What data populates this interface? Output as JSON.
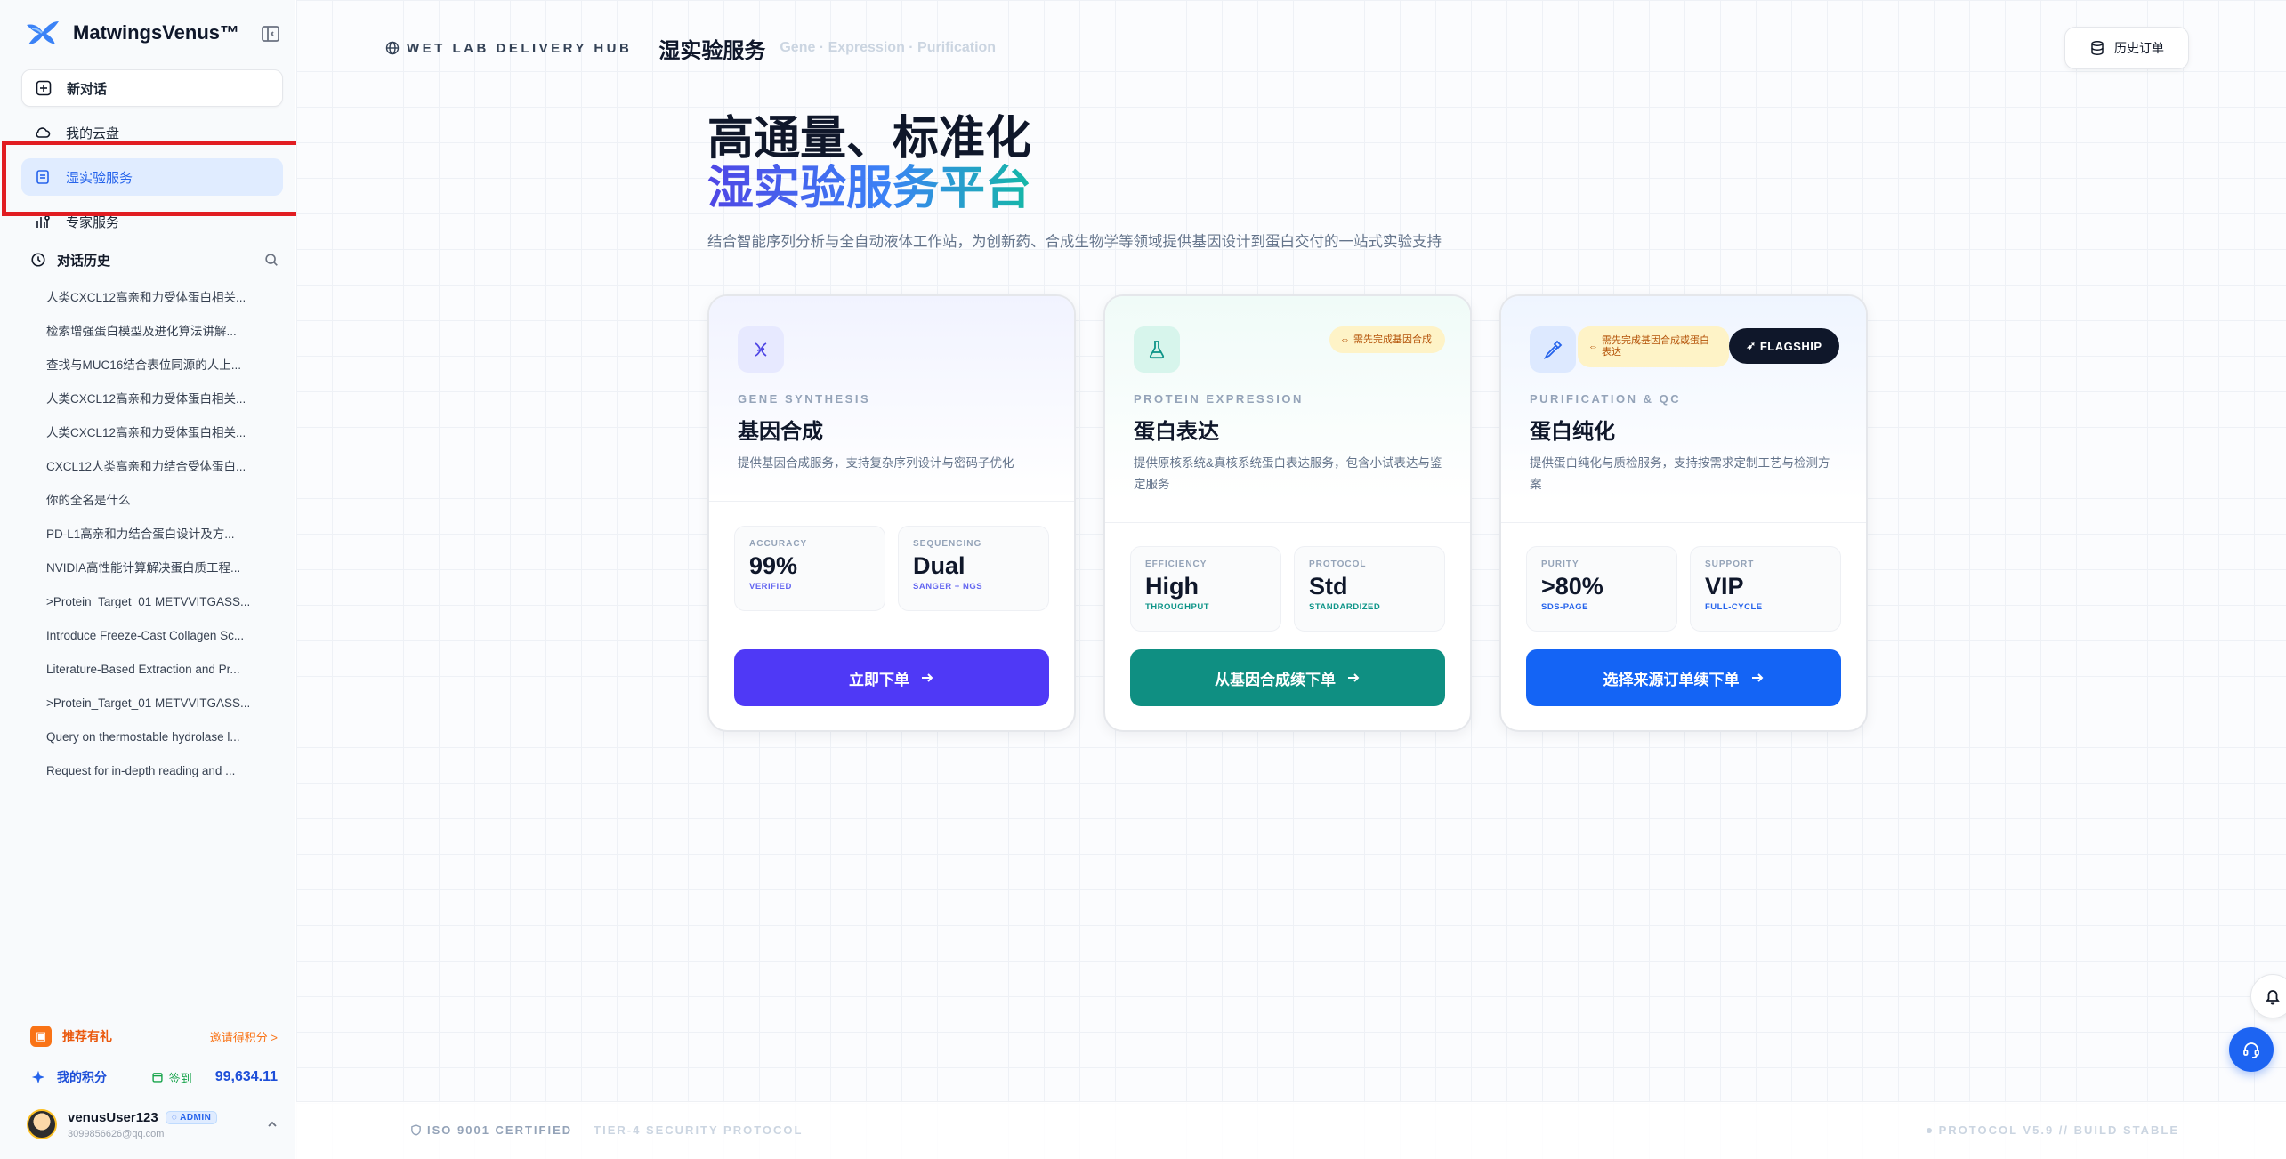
{
  "sidebar": {
    "brand": "MatwingsVenus™",
    "nav": {
      "new_chat": "新对话",
      "cloud": "我的云盘",
      "wetlab": "湿实验服务",
      "expert": "专家服务"
    },
    "history_title": "对话历史",
    "history": [
      "人类CXCL12高亲和力受体蛋白相关...",
      "检索增强蛋白模型及进化算法讲解...",
      "查找与MUC16结合表位同源的人上...",
      "人类CXCL12高亲和力受体蛋白相关...",
      "人类CXCL12高亲和力受体蛋白相关...",
      "CXCL12人类高亲和力结合受体蛋白...",
      "你的全名是什么",
      "PD-L1高亲和力结合蛋白设计及方...",
      "NVIDIA高性能计算解决蛋白质工程...",
      ">Protein_Target_01 METVVITGASS...",
      "Introduce Freeze-Cast Collagen Sc...",
      "Literature-Based Extraction and Pr...",
      ">Protein_Target_01 METVVITGASS...",
      "Query on thermostable hydrolase l...",
      "Request for in-depth reading and ..."
    ],
    "promo": {
      "title": "推荐有礼",
      "link": "邀请得积分 >"
    },
    "points": {
      "label": "我的积分",
      "checkin": "签到",
      "value": "99,634.11"
    },
    "user": {
      "name": "venusUser123",
      "badge": "ADMIN",
      "email": "3099856626@qq.com"
    }
  },
  "topbar": {
    "hub": "WET LAB DELIVERY HUB",
    "title": "湿实验服务",
    "subtitle": "Gene · Expression · Purification",
    "history_button": "历史订单"
  },
  "hero": {
    "line1": "高通量、标准化",
    "line2": "湿实验服务平台",
    "desc": "结合智能序列分析与全自动液体工作站，为创新药、合成生物学等领域提供基因设计到蛋白交付的一站式实验支持"
  },
  "cards": [
    {
      "eyebrow": "GENE SYNTHESIS",
      "title": "基因合成",
      "desc": "提供基因合成服务，支持复杂序列设计与密码子优化",
      "stats": [
        {
          "k": "ACCURACY",
          "v": "99%",
          "s": "VERIFIED"
        },
        {
          "k": "SEQUENCING",
          "v": "Dual",
          "s": "SANGER + NGS"
        }
      ],
      "button": "立即下单"
    },
    {
      "eyebrow": "PROTEIN EXPRESSION",
      "title": "蛋白表达",
      "desc": "提供原核系统&真核系统蛋白表达服务，包含小试表达与鉴定服务",
      "tag": "需先完成基因合成",
      "stats": [
        {
          "k": "EFFICIENCY",
          "v": "High",
          "s": "THROUGHPUT"
        },
        {
          "k": "PROTOCOL",
          "v": "Std",
          "s": "STANDARDIZED"
        }
      ],
      "button": "从基因合成续下单"
    },
    {
      "eyebrow": "PURIFICATION & QC",
      "title": "蛋白纯化",
      "desc": "提供蛋白纯化与质检服务，支持按需求定制工艺与检测方案",
      "tag": "需先完成基因合成或蛋白表达",
      "flagship": "FLAGSHIP",
      "stats": [
        {
          "k": "PURITY",
          "v": ">80%",
          "s": "SDS-PAGE"
        },
        {
          "k": "SUPPORT",
          "v": "VIP",
          "s": "FULL-CYCLE"
        }
      ],
      "button": "选择来源订单续下单"
    }
  ],
  "footer": {
    "iso": "ISO 9001 CERTIFIED",
    "tier": "TIER-4 SECURITY PROTOCOL",
    "protocol": "PROTOCOL V5.9 // BUILD STABLE"
  },
  "colors": {
    "accent_indigo": "#4f39f6",
    "accent_teal": "#0f8f82",
    "accent_blue": "#1464f5",
    "annotation_red": "#e11d22"
  },
  "icons": {
    "brand": "wing-logo",
    "new_chat": "plus-square-icon",
    "cloud": "cloud-icon",
    "wetlab": "clipboard-icon",
    "expert": "expert-icon",
    "history": "clock-icon",
    "card1": "dna-icon",
    "card2": "flask-icon",
    "card3": "pipette-icon"
  }
}
